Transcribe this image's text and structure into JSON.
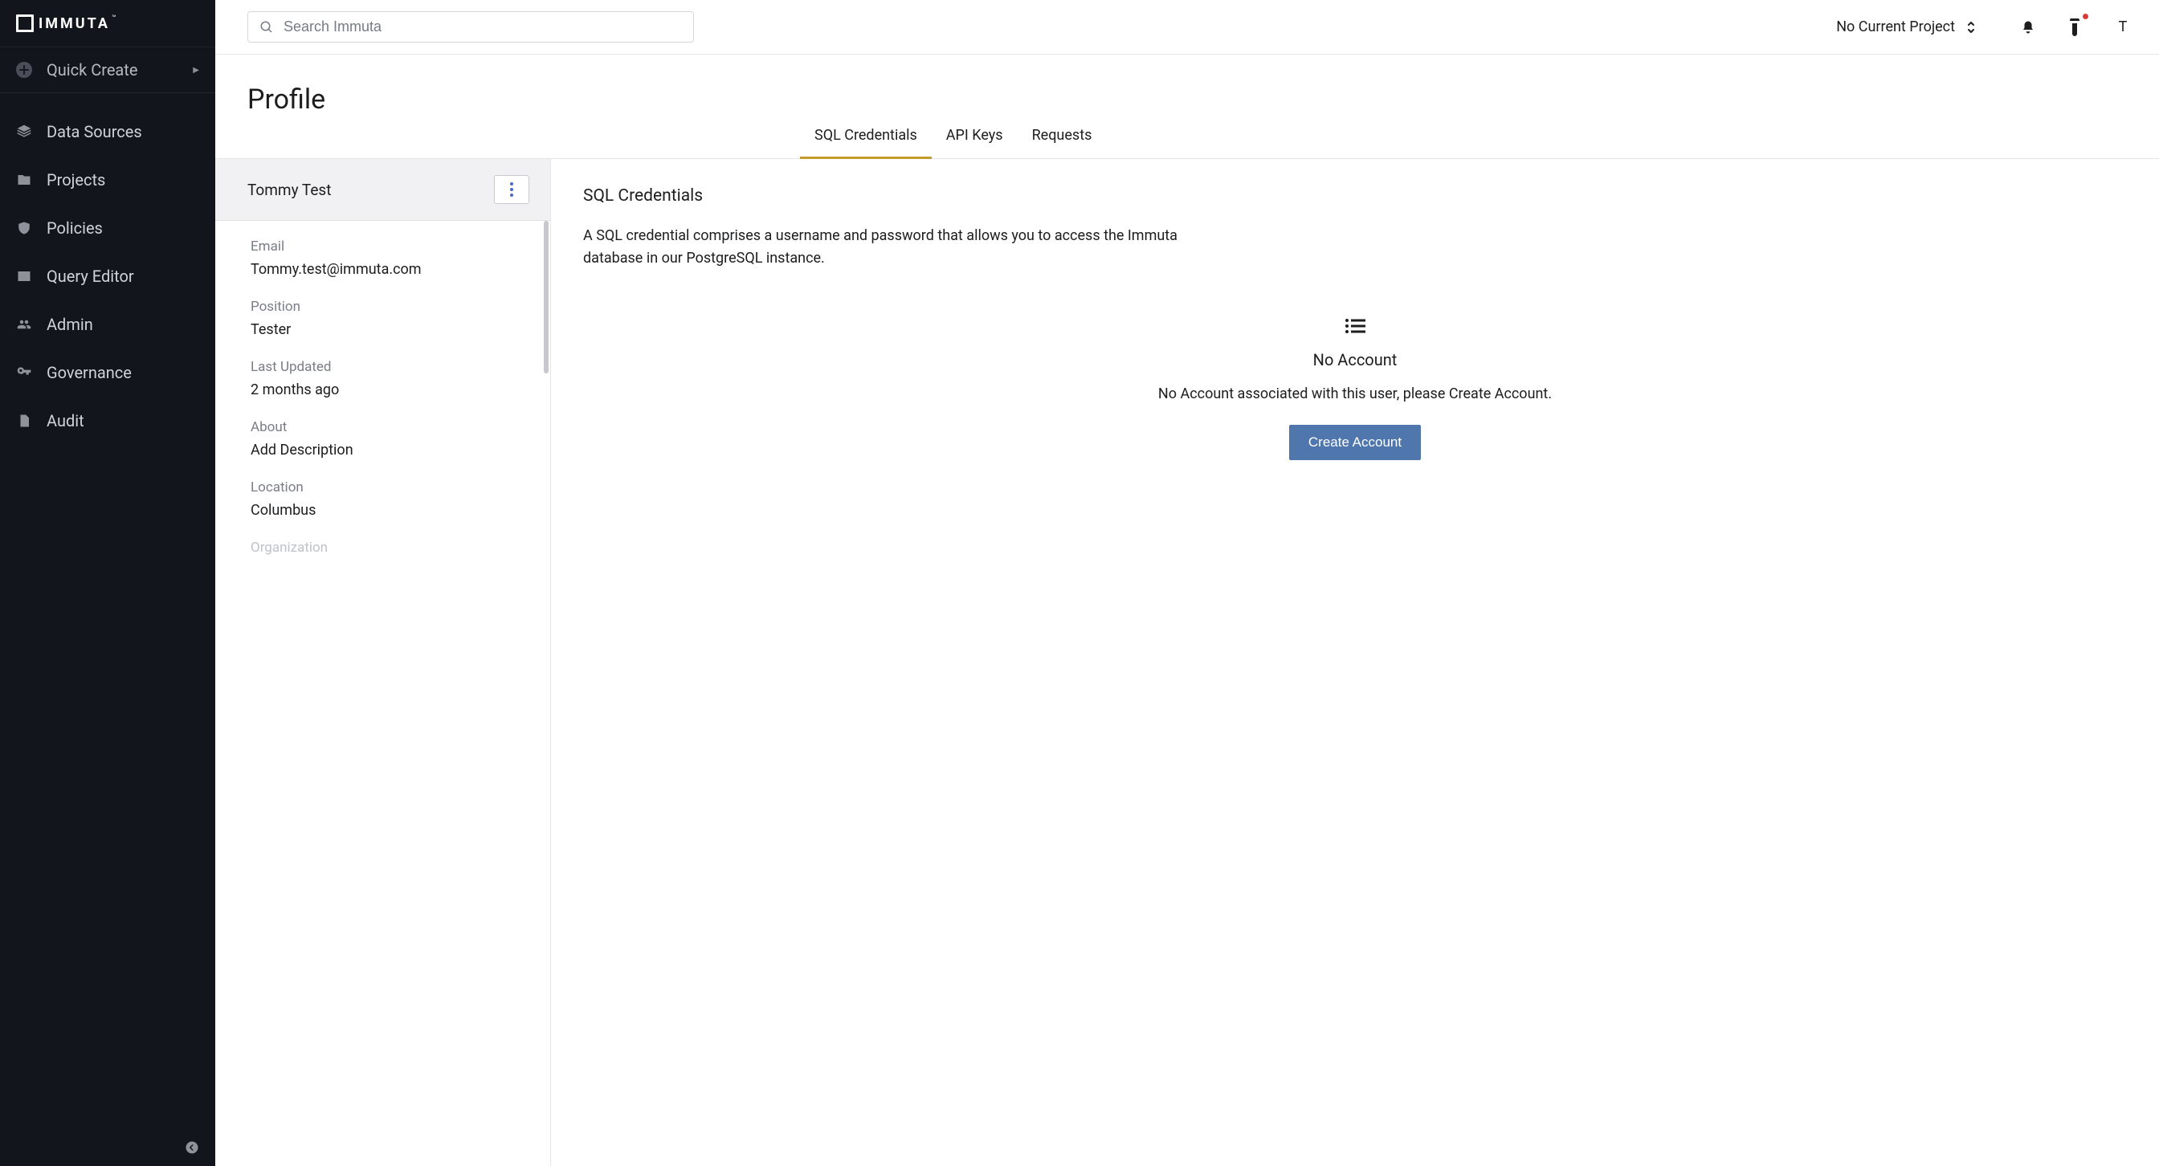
{
  "brand": {
    "name": "IMMUTA"
  },
  "sidebar": {
    "quick_create": "Quick Create",
    "items": [
      {
        "label": "Data Sources"
      },
      {
        "label": "Projects"
      },
      {
        "label": "Policies"
      },
      {
        "label": "Query Editor"
      },
      {
        "label": "Admin"
      },
      {
        "label": "Governance"
      },
      {
        "label": "Audit"
      }
    ]
  },
  "topbar": {
    "search_placeholder": "Search Immuta",
    "project_label": "No Current Project",
    "avatar_initial": "T"
  },
  "page": {
    "title": "Profile"
  },
  "tabs": [
    {
      "label": "SQL Credentials",
      "active": true
    },
    {
      "label": "API Keys",
      "active": false
    },
    {
      "label": "Requests",
      "active": false
    }
  ],
  "profile": {
    "name": "Tommy Test",
    "fields": [
      {
        "label": "Email",
        "value": "Tommy.test@immuta.com"
      },
      {
        "label": "Position",
        "value": "Tester"
      },
      {
        "label": "Last Updated",
        "value": "2 months ago"
      },
      {
        "label": "About",
        "value": "Add Description"
      },
      {
        "label": "Location",
        "value": "Columbus"
      }
    ],
    "cutoff_label": "Organization"
  },
  "sql_section": {
    "title": "SQL Credentials",
    "description": "A SQL credential comprises a username and password that allows you to access the Immuta database in our PostgreSQL instance.",
    "empty_title": "No Account",
    "empty_sub": "No Account associated with this user, please Create Account.",
    "button": "Create Account"
  }
}
